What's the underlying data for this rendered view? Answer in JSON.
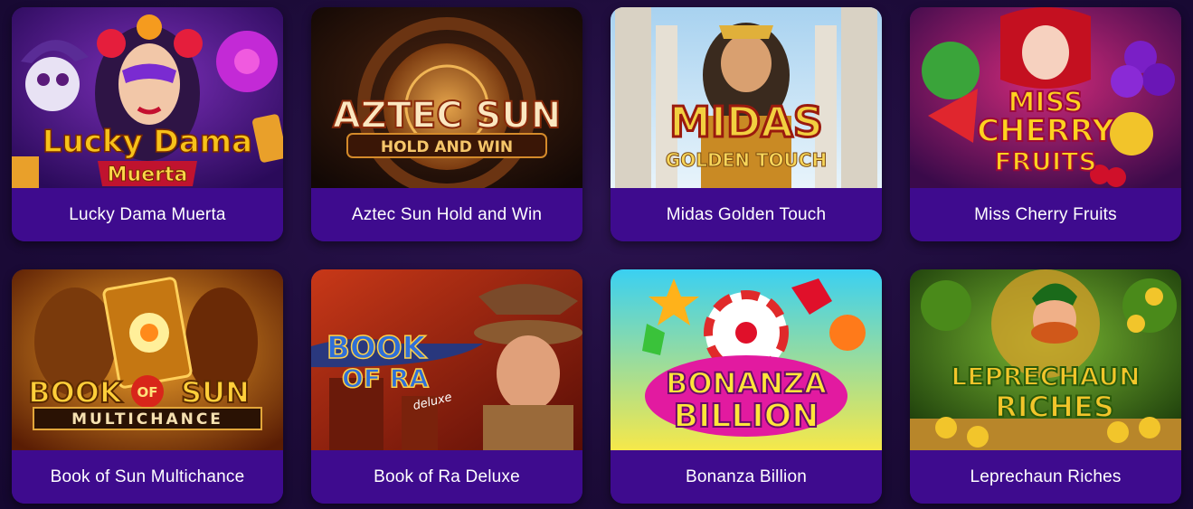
{
  "games": [
    {
      "title": "Lucky Dama Muerta",
      "logo_lines": [
        "Lucky Dama",
        "Muerta"
      ],
      "accent": "#f7c21a"
    },
    {
      "title": "Aztec Sun Hold and Win",
      "logo_lines": [
        "AZTEC SUN",
        "HOLD AND WIN"
      ],
      "accent": "#f59b2a"
    },
    {
      "title": "Midas Golden Touch",
      "logo_lines": [
        "MIDAS",
        "GOLDEN TOUCH"
      ],
      "accent": "#e02418"
    },
    {
      "title": "Miss Cherry Fruits",
      "logo_lines": [
        "MISS",
        "CHERRY",
        "FRUITS"
      ],
      "accent": "#ffd21f"
    },
    {
      "title": "Book of Sun Multichance",
      "logo_lines": [
        "BOOK",
        "OF",
        "SUN",
        "MULTICHANCE"
      ],
      "accent": "#ffcf3a"
    },
    {
      "title": "Book of Ra Deluxe",
      "logo_lines": [
        "BOOK",
        "OF RA",
        "deluxe"
      ],
      "accent": "#2f6fd8"
    },
    {
      "title": "Bonanza Billion",
      "logo_lines": [
        "BONANZA",
        "BILLION"
      ],
      "accent": "#ff3fa6"
    },
    {
      "title": "Leprechaun Riches",
      "logo_lines": [
        "LEPRECHAUN",
        "RICHES"
      ],
      "accent": "#f2c52b"
    }
  ]
}
